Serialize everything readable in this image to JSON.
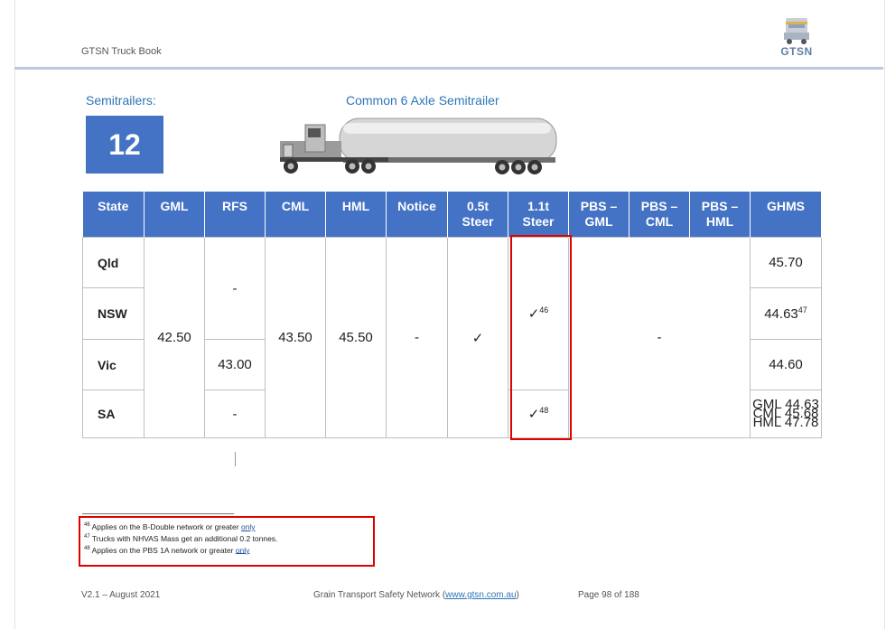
{
  "header": {
    "title": "GTSN Truck Book",
    "logo_text": "GTSN"
  },
  "section": {
    "label": "Semitrailers:",
    "number": "12",
    "title": "Common 6 Axle Semitrailer"
  },
  "table": {
    "headers": [
      [
        "State"
      ],
      [
        "GML"
      ],
      [
        "RFS"
      ],
      [
        "CML"
      ],
      [
        "HML"
      ],
      [
        "Notice"
      ],
      [
        "0.5t",
        "Steer"
      ],
      [
        "1.1t",
        "Steer"
      ],
      [
        "PBS –",
        "GML"
      ],
      [
        "PBS –",
        "CML"
      ],
      [
        "PBS –",
        "HML"
      ],
      [
        "GHMS"
      ]
    ],
    "states": [
      "Qld",
      "NSW",
      "Vic",
      "SA"
    ],
    "gml": "42.50",
    "rfs_top": "-",
    "rfs_vic": "43.00",
    "rfs_sa": "-",
    "cml": "43.50",
    "hml": "45.50",
    "notice": "-",
    "steer05": "✓",
    "steer11_main": "✓",
    "steer11_main_sup": "46",
    "steer11_sa": "✓",
    "steer11_sa_sup": "48",
    "pbs": "-",
    "ghms_qld": "45.70",
    "ghms_nsw": "44.63",
    "ghms_nsw_sup": "47",
    "ghms_vic": "44.60",
    "ghms_sa": [
      "GML 44.63",
      "CML 45.68",
      "HML 47.78"
    ]
  },
  "footnotes": [
    {
      "num": "46",
      "text": "Applies on the B-Double network or greater ",
      "emph": "only"
    },
    {
      "num": "47",
      "text": "Trucks with NHVAS Mass get an additional 0.2 tonnes.",
      "emph": ""
    },
    {
      "num": "48",
      "text": "Applies on the PBS 1A network or greater ",
      "emph": "only"
    }
  ],
  "footer": {
    "version": "V2.1 – August 2021",
    "network_text": "Grain Transport Safety Network (",
    "network_link": "www.gtsn.com.au",
    "network_close": ")",
    "page": "Page 98 of 188"
  },
  "colors": {
    "header_blue": "#4472c4",
    "title_blue": "#2e75b6",
    "highlight_red": "#e00000"
  }
}
